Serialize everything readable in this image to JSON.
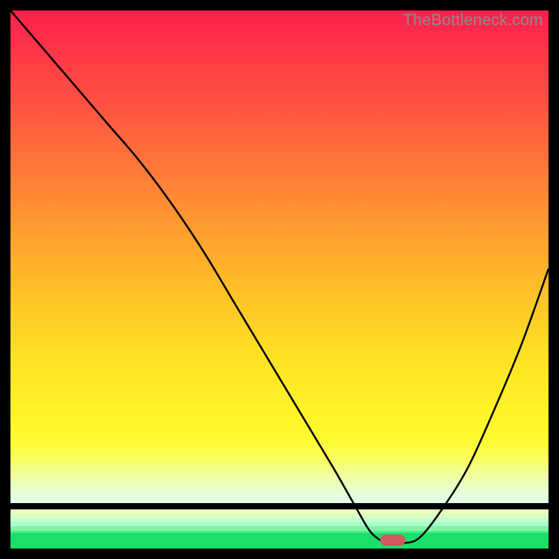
{
  "watermark": "TheBottleneck.com",
  "colors": {
    "curve": "#000000",
    "marker": "#d05a5f",
    "green_band": "#18e06a"
  },
  "chart_data": {
    "type": "line",
    "title": "",
    "xlabel": "",
    "ylabel": "",
    "xlim": [
      0,
      100
    ],
    "ylim": [
      0,
      100
    ],
    "series": [
      {
        "name": "bottleneck-curve",
        "x": [
          0,
          6,
          12,
          18,
          24,
          30,
          36,
          42,
          48,
          54,
          60,
          64,
          67,
          70,
          73,
          76,
          80,
          85,
          90,
          95,
          100
        ],
        "y": [
          100,
          93,
          86,
          79,
          72,
          64,
          55,
          45,
          35,
          25,
          15,
          8,
          3,
          1,
          1,
          2,
          7,
          15,
          26,
          38,
          52
        ]
      }
    ],
    "minimum_marker": {
      "x": 71,
      "y": 1.5
    },
    "gradient_stops": [
      {
        "pct": 0,
        "color": "#ff1f4e"
      },
      {
        "pct": 20,
        "color": "#ff5540"
      },
      {
        "pct": 46,
        "color": "#ffa12e"
      },
      {
        "pct": 70,
        "color": "#ffe024"
      },
      {
        "pct": 87,
        "color": "#fffb2f"
      },
      {
        "pct": 97,
        "color": "#e8ffca"
      },
      {
        "pct": 100,
        "color": "#e0fff0"
      }
    ],
    "pale_bands_y": [
      93.0,
      93.8,
      94.6,
      95.4,
      96.2,
      97.0
    ]
  }
}
